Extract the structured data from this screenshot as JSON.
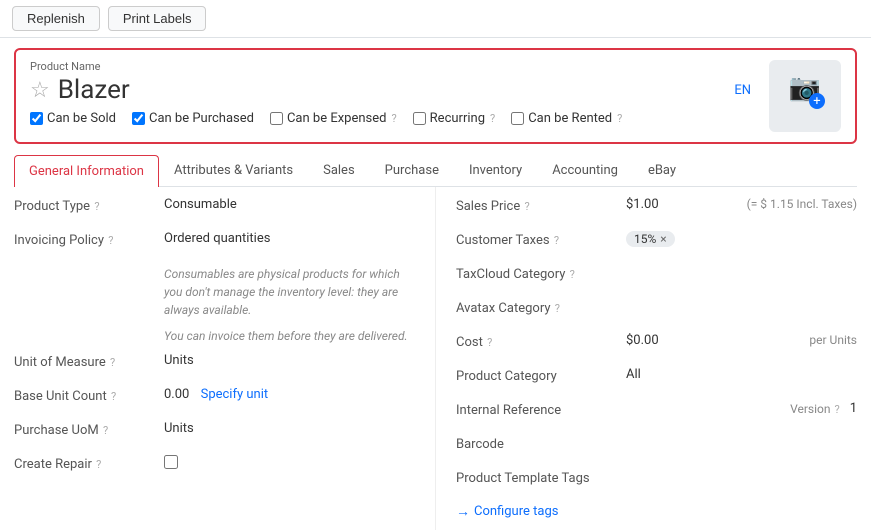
{
  "toolbar": {
    "replenish_label": "Replenish",
    "print_labels_label": "Print Labels"
  },
  "product": {
    "name_label": "Product Name",
    "name": "Blazer",
    "en_badge": "EN",
    "can_be_sold": true,
    "can_be_purchased": true,
    "can_be_expensed": false,
    "recurring": false,
    "can_be_rented": false,
    "can_be_sold_label": "Can be Sold",
    "can_be_purchased_label": "Can be Purchased",
    "can_be_expensed_label": "Can be Expensed",
    "recurring_label": "Recurring",
    "can_be_rented_label": "Can be Rented"
  },
  "tabs": [
    {
      "id": "general",
      "label": "General Information",
      "active": true
    },
    {
      "id": "attributes",
      "label": "Attributes & Variants",
      "active": false
    },
    {
      "id": "sales",
      "label": "Sales",
      "active": false
    },
    {
      "id": "purchase",
      "label": "Purchase",
      "active": false
    },
    {
      "id": "inventory",
      "label": "Inventory",
      "active": false
    },
    {
      "id": "accounting",
      "label": "Accounting",
      "active": false
    },
    {
      "id": "ebay",
      "label": "eBay",
      "active": false
    }
  ],
  "left_fields": {
    "product_type_label": "Product Type",
    "product_type_value": "Consumable",
    "invoicing_policy_label": "Invoicing Policy",
    "invoicing_policy_value": "Ordered quantities",
    "consumable_desc1": "Consumables are physical products for which you don't manage the inventory level: they are always available.",
    "consumable_desc2": "You can invoice them before they are delivered.",
    "unit_of_measure_label": "Unit of Measure",
    "unit_of_measure_value": "Units",
    "base_unit_count_label": "Base Unit Count",
    "base_unit_count_value": "0.00",
    "specify_unit_label": "Specify unit",
    "purchase_uom_label": "Purchase UoM",
    "purchase_uom_value": "Units",
    "create_repair_label": "Create Repair"
  },
  "right_fields": {
    "sales_price_label": "Sales Price",
    "sales_price_value": "$1.00",
    "sales_price_incl": "(= $ 1.15 Incl. Taxes)",
    "customer_taxes_label": "Customer Taxes",
    "customer_taxes_badge": "15%",
    "taxcloud_category_label": "TaxCloud Category",
    "avatax_category_label": "Avatax Category",
    "cost_label": "Cost",
    "cost_value": "$0.00",
    "cost_unit": "per Units",
    "product_category_label": "Product Category",
    "product_category_value": "All",
    "internal_reference_label": "Internal Reference",
    "version_label": "Version",
    "version_value": "1",
    "barcode_label": "Barcode",
    "product_template_tags_label": "Product Template Tags",
    "configure_tags_label": "Configure tags"
  }
}
